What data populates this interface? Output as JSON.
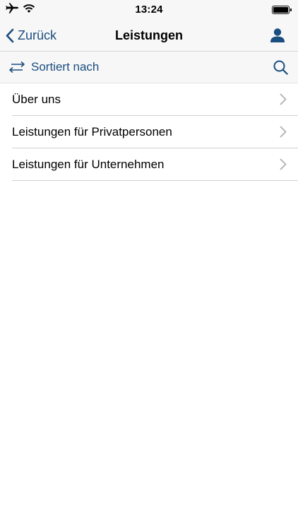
{
  "status_bar": {
    "time": "13:24",
    "battery_level": 1.0
  },
  "nav": {
    "back_label": "Zurück",
    "title": "Leistungen",
    "accent_color": "#1a4d80",
    "icons": {
      "back": "chevron-left-icon",
      "user": "user-icon"
    }
  },
  "sort": {
    "label": "Sortiert nach",
    "icons": {
      "sort": "swap-arrows-icon",
      "search": "search-icon"
    }
  },
  "list": {
    "items": [
      {
        "label": "Über uns"
      },
      {
        "label": "Leistungen für Privatpersonen"
      },
      {
        "label": "Leistungen für Unternehmen"
      }
    ]
  }
}
